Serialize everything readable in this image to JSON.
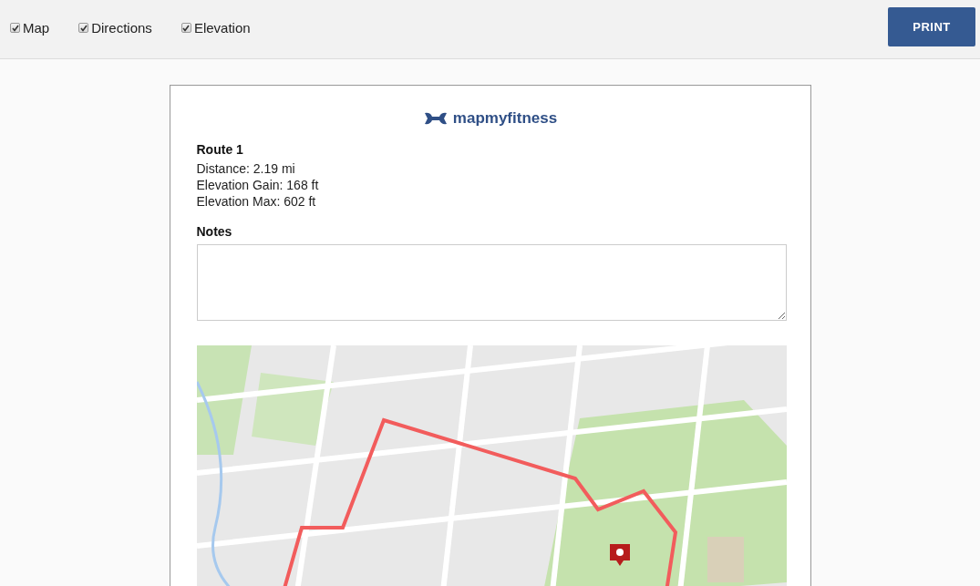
{
  "toolbar": {
    "options": [
      {
        "label": "Map",
        "checked": true
      },
      {
        "label": "Directions",
        "checked": true
      },
      {
        "label": "Elevation",
        "checked": true
      }
    ],
    "print_button": "PRINT"
  },
  "sheet": {
    "logo": "mapmyfitness",
    "route": {
      "title": "Route 1",
      "stats": [
        "Distance: 2.19 mi",
        "Elevation Gain: 168 ft",
        "Elevation Max: 602 ft"
      ]
    },
    "notes": {
      "label": "Notes"
    }
  }
}
